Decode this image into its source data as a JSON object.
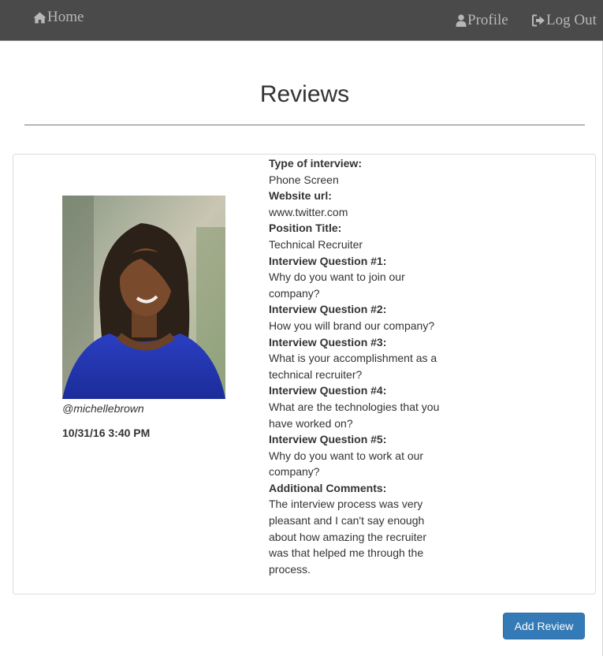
{
  "nav": {
    "home_label": "Home",
    "profile_label": "Profile",
    "logout_label": "Log Out"
  },
  "page": {
    "title": "Reviews"
  },
  "review": {
    "username": "@michellebrown",
    "timestamp": "10/31/16 3:40 PM",
    "fields": [
      {
        "label": "Type of interview:",
        "value": "Phone Screen"
      },
      {
        "label": "Website url:",
        "value": "www.twitter.com"
      },
      {
        "label": "Position Title:",
        "value": "Technical Recruiter"
      },
      {
        "label": "Interview Question #1:",
        "value": "Why do you want to join our company?"
      },
      {
        "label": "Interview Question #2:",
        "value": "How you will brand our company?"
      },
      {
        "label": "Interview Question #3:",
        "value": "What is your accomplishment as a technical recruiter?"
      },
      {
        "label": "Interview Question #4:",
        "value": "What are the technologies that you have worked on?"
      },
      {
        "label": "Interview Question #5:",
        "value": "Why do you want to work at our company?"
      },
      {
        "label": "Additional Comments:",
        "value": "The interview process was very pleasant and I can't say enough about how amazing the recruiter was that helped me through the process."
      }
    ]
  },
  "actions": {
    "add_review_label": "Add Review"
  },
  "colors": {
    "navbar_bg": "#4a4a4a",
    "nav_text": "#b7b7b7",
    "primary_button": "#337ab7"
  }
}
